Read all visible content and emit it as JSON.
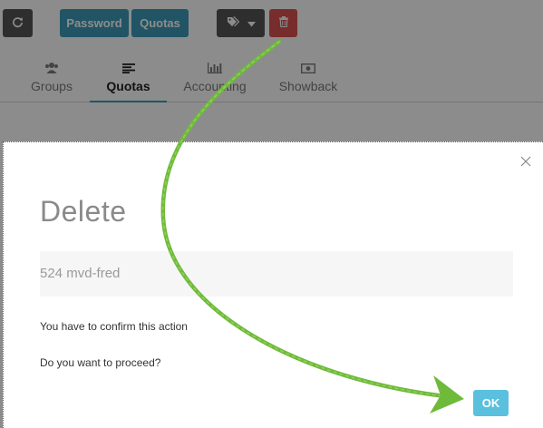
{
  "toolbar": {
    "password_label": "Password",
    "quotas_label": "Quotas"
  },
  "tabs": [
    {
      "label": "Groups"
    },
    {
      "label": "Quotas"
    },
    {
      "label": "Accounting"
    },
    {
      "label": "Showback"
    }
  ],
  "modal": {
    "title": "Delete",
    "resource": "524 mvd-fred",
    "confirm_text": "You have to confirm this action",
    "proceed_text": "Do you want to proceed?",
    "ok_label": "OK"
  },
  "colors": {
    "primary": "#3d9bb8",
    "danger": "#d9534f",
    "ok": "#5bc0de",
    "default": "#555555",
    "annotation_arrow": "#6fba3a"
  },
  "icons": {
    "refresh": "refresh-icon",
    "tags": "tags-icon",
    "dropdown": "caret-down-icon",
    "delete": "trash-icon",
    "groups": "users-icon",
    "quotas": "list-icon",
    "accounting": "bar-chart-icon",
    "showback": "money-icon",
    "close": "close-icon"
  }
}
